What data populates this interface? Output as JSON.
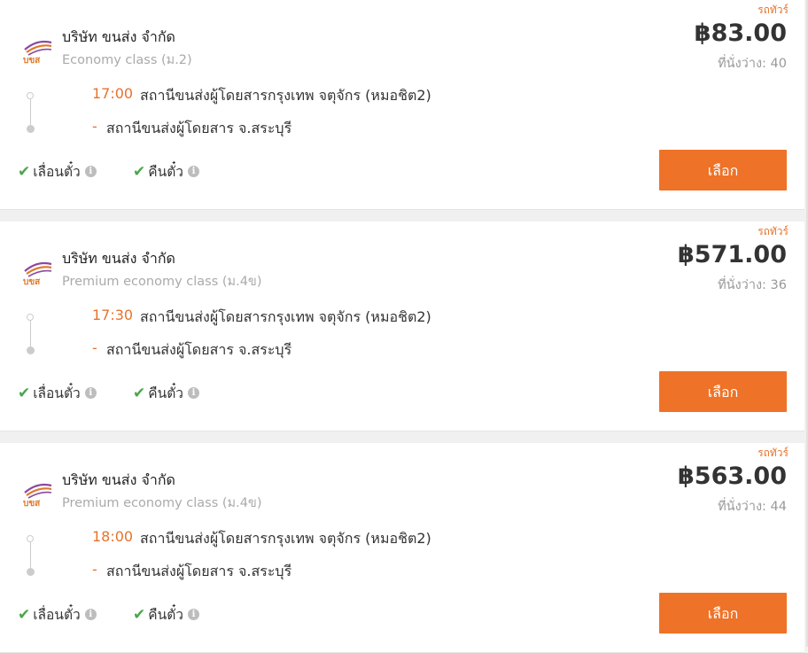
{
  "colors": {
    "accent": "#ee7228",
    "check": "#4aa64a",
    "muted": "#999999"
  },
  "trips": [
    {
      "tag": "รถทัวร์",
      "company": "บริษัท ขนส่ง จำกัด",
      "class": "Economy class (ม.2)",
      "price": "฿83.00",
      "seats": "ที่นั่งว่าง: 40",
      "departure_time": "17:00",
      "departure_station": "สถานีขนส่งผู้โดยสารกรุงเทพ จตุจักร (หมอชิต2)",
      "arrival_dash": "-",
      "arrival_station": "สถานีขนส่งผู้โดยสาร จ.สระบุรี",
      "feature1": "เลื่อนตั๋ว",
      "feature2": "คืนตั๋ว",
      "button": "เลือก"
    },
    {
      "tag": "รถทัวร์",
      "company": "บริษัท ขนส่ง จำกัด",
      "class": "Premium economy class (ม.4ข)",
      "price": "฿571.00",
      "seats": "ที่นั่งว่าง: 36",
      "departure_time": "17:30",
      "departure_station": "สถานีขนส่งผู้โดยสารกรุงเทพ จตุจักร (หมอชิต2)",
      "arrival_dash": "-",
      "arrival_station": "สถานีขนส่งผู้โดยสาร จ.สระบุรี",
      "feature1": "เลื่อนตั๋ว",
      "feature2": "คืนตั๋ว",
      "button": "เลือก"
    },
    {
      "tag": "รถทัวร์",
      "company": "บริษัท ขนส่ง จำกัด",
      "class": "Premium economy class (ม.4ข)",
      "price": "฿563.00",
      "seats": "ที่นั่งว่าง: 44",
      "departure_time": "18:00",
      "departure_station": "สถานีขนส่งผู้โดยสารกรุงเทพ จตุจักร (หมอชิต2)",
      "arrival_dash": "-",
      "arrival_station": "สถานีขนส่งผู้โดยสาร จ.สระบุรี",
      "feature1": "เลื่อนตั๋ว",
      "feature2": "คืนตั๋ว",
      "button": "เลือก"
    }
  ],
  "logo_text": "บขส",
  "icons": {
    "check": "check-icon",
    "info": "info-icon",
    "logo": "bus-company-logo"
  }
}
